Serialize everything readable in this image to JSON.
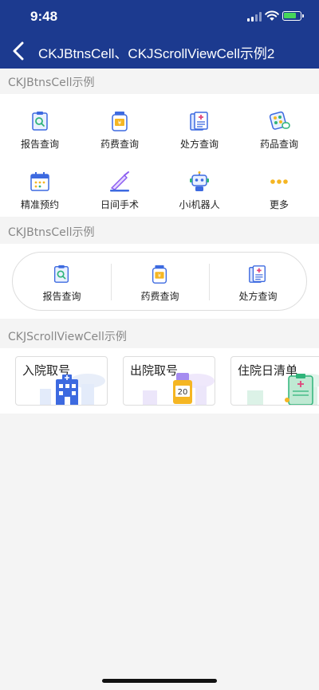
{
  "status": {
    "time": "9:48"
  },
  "nav": {
    "title": "CKJBtnsCell、CKJScrollViewCell示例2"
  },
  "section1": {
    "header": "CKJBtnsCell示例",
    "items": [
      {
        "label": "报告查询",
        "icon": "report-query-icon"
      },
      {
        "label": "药费查询",
        "icon": "medicine-fee-icon"
      },
      {
        "label": "处方查询",
        "icon": "prescription-icon"
      },
      {
        "label": "药品查询",
        "icon": "drug-query-icon"
      },
      {
        "label": "精准预约",
        "icon": "calendar-icon"
      },
      {
        "label": "日间手术",
        "icon": "scalpel-icon"
      },
      {
        "label": "小i机器人",
        "icon": "robot-icon"
      },
      {
        "label": "更多",
        "icon": "more-dots-icon"
      }
    ]
  },
  "section2": {
    "header": "CKJBtnsCell示例",
    "items": [
      {
        "label": "报告查询",
        "icon": "report-query-icon"
      },
      {
        "label": "药费查询",
        "icon": "medicine-fee-icon"
      },
      {
        "label": "处方查询",
        "icon": "prescription-icon"
      }
    ]
  },
  "section3": {
    "header": "CKJScrollViewCell示例",
    "cards": [
      {
        "label": "入院取号",
        "icon": "hospital-building-icon"
      },
      {
        "label": "出院取号",
        "icon": "queue-number-icon",
        "badge": "20"
      },
      {
        "label": "住院日清单",
        "icon": "clipboard-list-icon"
      }
    ]
  },
  "colors": {
    "navbar": "#1c3a8f",
    "accent_blue": "#3d6ae0",
    "accent_green": "#2fb47a",
    "accent_yellow": "#f5b623"
  }
}
